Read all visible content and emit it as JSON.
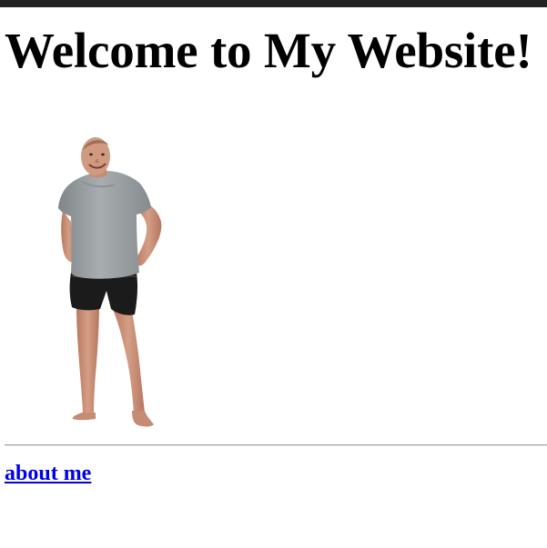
{
  "page": {
    "title": "Welcome to My Website!"
  },
  "photo": {
    "subject": "person-standing-photo",
    "colors": {
      "shirt": "#9fa4a6",
      "shorts": "#1b1b1b",
      "skin": "#c98f75"
    }
  },
  "nav": {
    "about_label": "about me"
  },
  "colors": {
    "top_bar": "#222222",
    "link": "#0000ee",
    "text": "#000000",
    "background": "#ffffff"
  }
}
